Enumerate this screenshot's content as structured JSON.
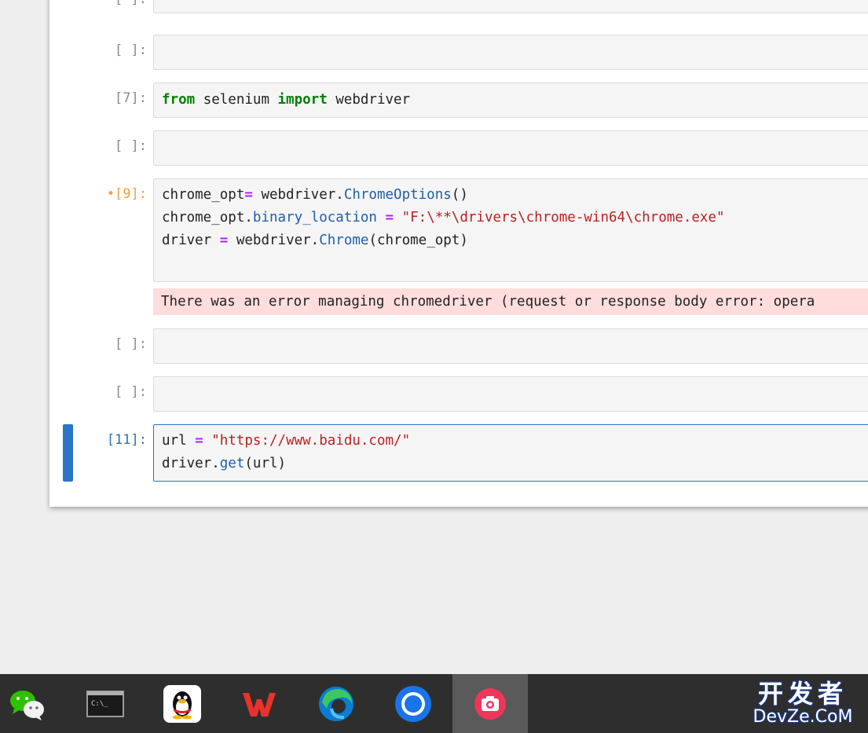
{
  "cells": [
    {
      "prompt": "[ ]:"
    },
    {
      "prompt": "[ ]:"
    },
    {
      "prompt": "[7]:",
      "code": {
        "kw1": "from",
        "mod": " selenium ",
        "kw2": "import",
        "name": " webdriver"
      }
    },
    {
      "prompt": "[ ]:"
    },
    {
      "prompt": "•[9]:",
      "line1": {
        "a": "chrome_opt",
        "eq": "=",
        "b": " webdriver.",
        "fn": "ChromeOptions",
        "c": "()"
      },
      "line2": {
        "a": "chrome_opt.",
        "attr": "binary_location",
        "b": " ",
        "eq": "=",
        "c": " ",
        "str": "\"F:\\**\\drivers\\chrome-win64\\chrome.exe\""
      },
      "line3": {
        "a": "driver ",
        "eq": "=",
        "b": " webdriver.",
        "fn": "Chrome",
        "c": "(chrome_opt)"
      },
      "stderr": "There was an error managing chromedriver (request or response body error: opera"
    },
    {
      "prompt": "[ ]:"
    },
    {
      "prompt": "[ ]:"
    },
    {
      "prompt": "[11]:",
      "line1": {
        "a": "url ",
        "eq": "=",
        "b": " ",
        "str": "\"https://www.baidu.com/\""
      },
      "line2": {
        "a": "driver.",
        "fn": "get",
        "b": "(url)"
      }
    }
  ],
  "taskbar": {
    "apps": [
      "wechat-icon",
      "terminal-icon",
      "qq-icon",
      "wps-icon",
      "edge-icon",
      "chrome-icon",
      "screen-recorder-icon"
    ],
    "terminal_label": "C:\\_",
    "active_index": 6
  },
  "watermark": {
    "top": "开发者",
    "bottom": "DevZe.CoM"
  },
  "colors": {
    "active": "#2a75c9",
    "dirty": "#f0a040",
    "keyword": "#008000",
    "operator": "#aa22ff",
    "string": "#ba2121",
    "function": "#1f5ea8",
    "stderr_bg": "#ffdddd"
  }
}
